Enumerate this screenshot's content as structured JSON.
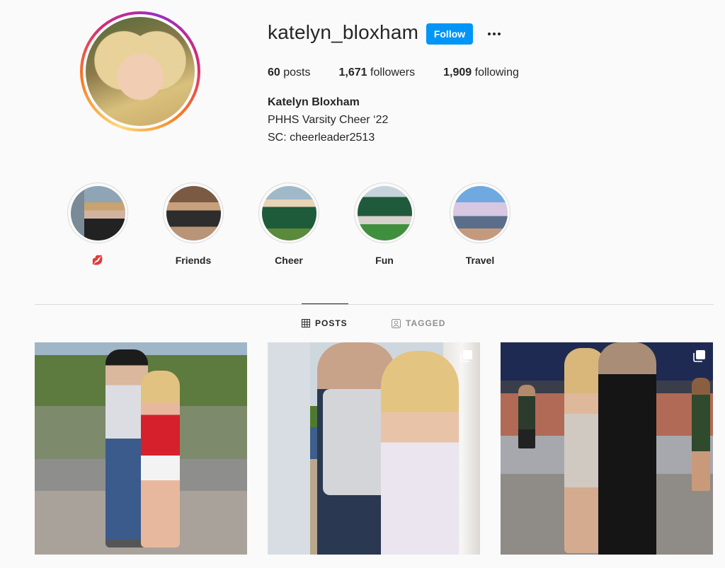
{
  "profile": {
    "username": "katelyn_bloxham",
    "follow_label": "Follow",
    "stats": {
      "posts_count": "60",
      "posts_label": "posts",
      "followers_count": "1,671",
      "followers_label": "followers",
      "following_count": "1,909",
      "following_label": "following"
    },
    "full_name": "Katelyn Bloxham",
    "bio_lines": [
      "PHHS Varsity Cheer ‘22",
      "SC: cheerleader2513"
    ]
  },
  "highlights": [
    {
      "label": "💋",
      "icon": "lips-emoji"
    },
    {
      "label": "Friends"
    },
    {
      "label": "Cheer"
    },
    {
      "label": "Fun"
    },
    {
      "label": "Travel"
    }
  ],
  "tabs": [
    {
      "label": "POSTS",
      "icon": "grid-icon",
      "active": true
    },
    {
      "label": "TAGGED",
      "icon": "tagged-user-icon",
      "active": false
    }
  ],
  "posts": [
    {
      "multiple": false
    },
    {
      "multiple": true,
      "icon": "carousel-icon"
    },
    {
      "multiple": true,
      "icon": "carousel-icon"
    }
  ],
  "colors": {
    "follow_button": "#0095f6",
    "background": "#fafafa",
    "divider": "#dbdbdb",
    "muted_text": "#8e8e8e"
  }
}
